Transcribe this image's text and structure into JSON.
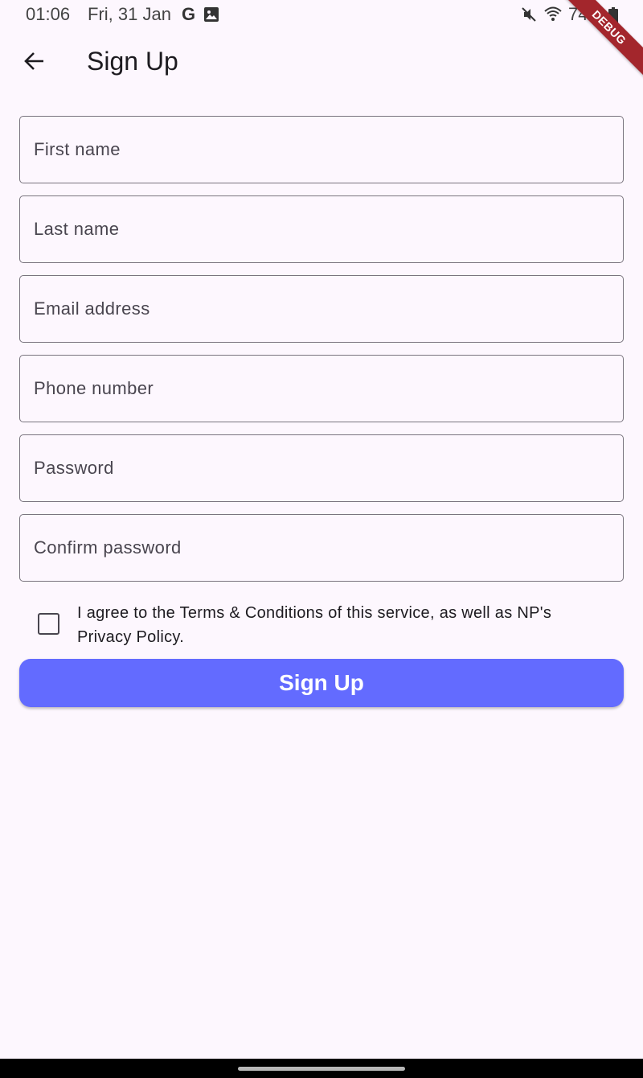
{
  "status_bar": {
    "time": "01:06",
    "date": "Fri, 31 Jan",
    "google_letter": "G",
    "battery_percent": "74%",
    "icons": [
      "google-icon",
      "gallery-icon",
      "mute-icon",
      "wifi-icon",
      "battery-icon"
    ]
  },
  "debug_banner": "DEBUG",
  "app_bar": {
    "title": "Sign Up",
    "back_icon": "arrow-back-icon"
  },
  "form": {
    "first_name": {
      "placeholder": "First name",
      "value": ""
    },
    "last_name": {
      "placeholder": "Last name",
      "value": ""
    },
    "email": {
      "placeholder": "Email address",
      "value": ""
    },
    "phone": {
      "placeholder": "Phone number",
      "value": ""
    },
    "password": {
      "placeholder": "Password",
      "value": ""
    },
    "confirm_password": {
      "placeholder": "Confirm password",
      "value": ""
    }
  },
  "agreement": {
    "checked": false,
    "text": "I agree to the Terms & Conditions of this service, as well as NP's Privacy Policy."
  },
  "submit_label": "Sign Up",
  "colors": {
    "background": "#fdf7fe",
    "primary_button": "#636bff",
    "outline": "#79747e",
    "debug_ribbon": "#a3262c"
  }
}
